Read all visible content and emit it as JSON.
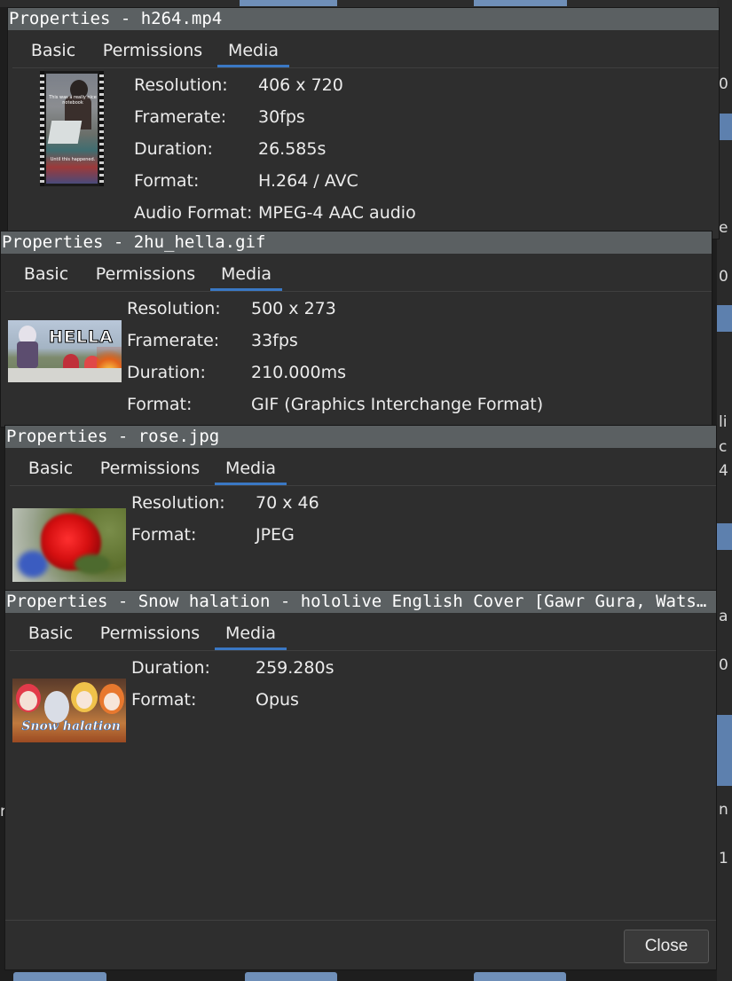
{
  "tabs": [
    "Basic",
    "Permissions",
    "Media"
  ],
  "background": {
    "right_edge_fragments": [
      "0",
      "e",
      "0",
      "li",
      "c",
      "4",
      "a",
      "0",
      "n",
      "1"
    ],
    "left_edge_fragments": [
      "r",
      "r"
    ]
  },
  "windows": [
    {
      "title": "Properties - h264.mp4",
      "active_tab": "Media",
      "thumbnail": {
        "caption_top": "This was a really nice notebook",
        "caption_bottom": "Until this happened."
      },
      "fields": [
        {
          "label": "Resolution:",
          "value": "406 x 720"
        },
        {
          "label": "Framerate:",
          "value": "30fps"
        },
        {
          "label": "Duration:",
          "value": "26.585s"
        },
        {
          "label": "Format:",
          "value": "H.264 / AVC"
        },
        {
          "label": "Audio Format:",
          "value": "MPEG-4 AAC audio"
        }
      ]
    },
    {
      "title": "Properties - 2hu_hella.gif",
      "active_tab": "Media",
      "thumbnail": {
        "caption": "HELLA"
      },
      "fields": [
        {
          "label": "Resolution:",
          "value": "500 x 273"
        },
        {
          "label": "Framerate:",
          "value": "33fps"
        },
        {
          "label": "Duration:",
          "value": "210.000ms"
        },
        {
          "label": "Format:",
          "value": "GIF (Graphics Interchange Format)"
        }
      ]
    },
    {
      "title": "Properties - rose.jpg",
      "active_tab": "Media",
      "fields": [
        {
          "label": "Resolution:",
          "value": "70 x 46"
        },
        {
          "label": "Format:",
          "value": "JPEG"
        }
      ]
    },
    {
      "title": "Properties - Snow halation - hololive English Cover [Gawr Gura, Watson Amelia]",
      "active_tab": "Media",
      "thumbnail": {
        "caption": "Snow halation"
      },
      "fields": [
        {
          "label": "Duration:",
          "value": "259.280s"
        },
        {
          "label": "Format:",
          "value": "Opus"
        }
      ],
      "close_label": "Close"
    }
  ]
}
